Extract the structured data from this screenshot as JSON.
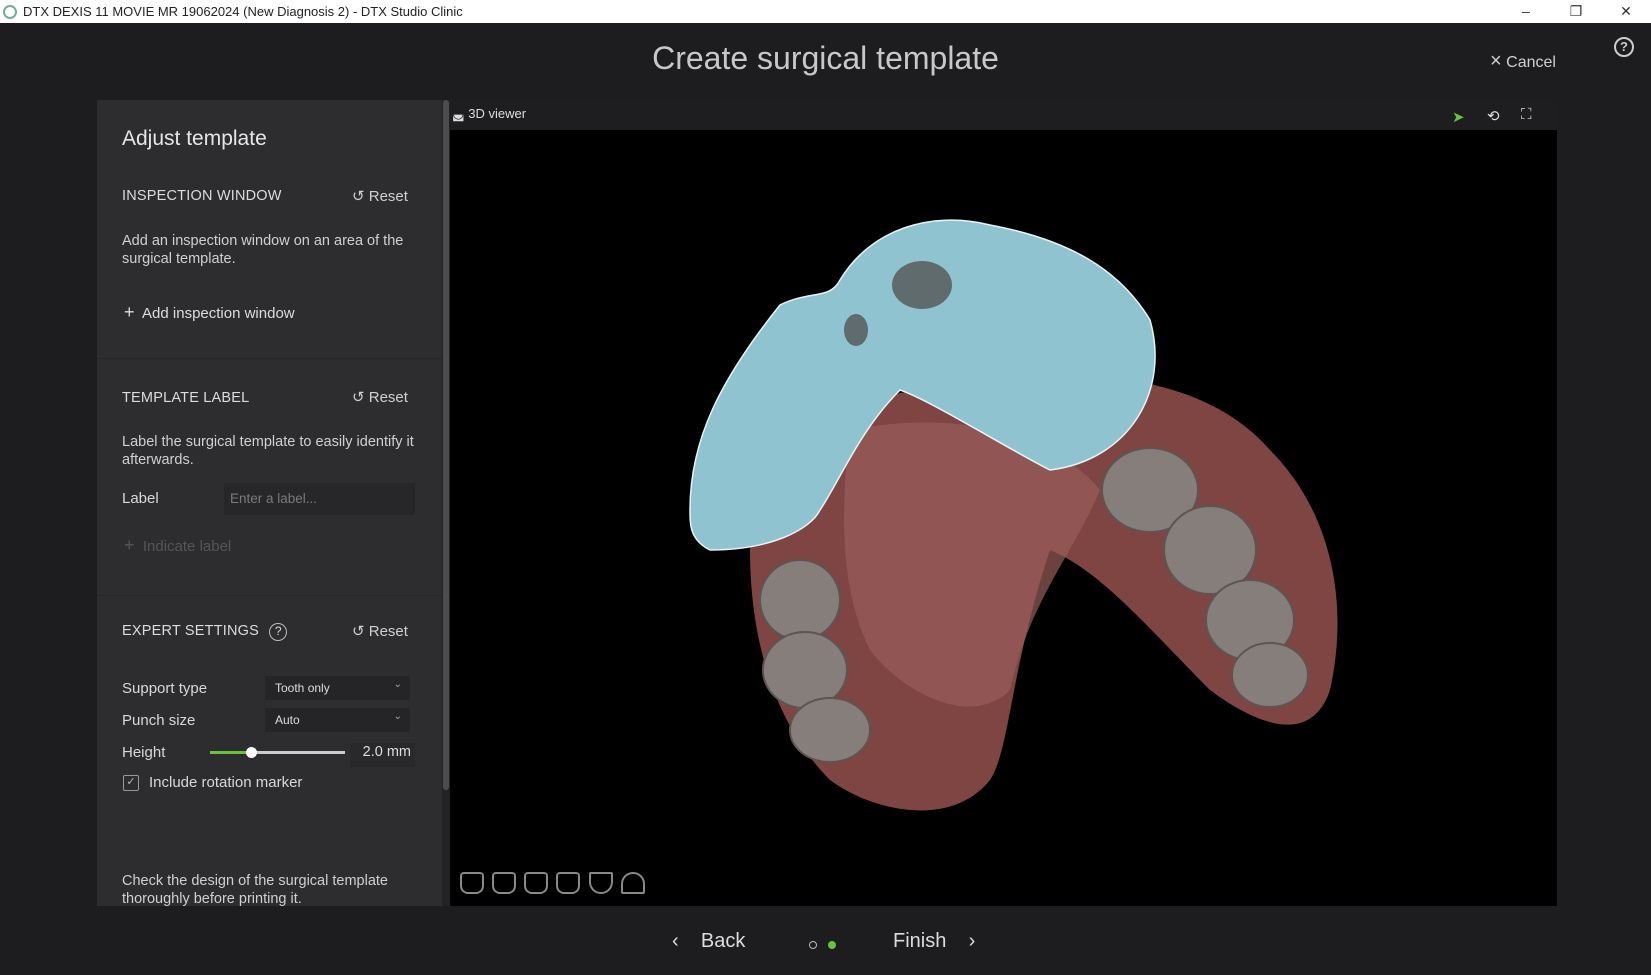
{
  "window": {
    "title": "DTX DEXIS 11 MOVIE MR 19062024 (New Diagnosis 2) - DTX Studio Clinic",
    "minimize": "‒",
    "restore": "❐",
    "close": "✕"
  },
  "header": {
    "title": "Create surgical template",
    "cancel_label": "Cancel",
    "cancel_icon": "×",
    "help_icon": "?"
  },
  "panel": {
    "title": "Adjust template",
    "inspection": {
      "heading": "INSPECTION WINDOW",
      "reset": "Reset",
      "description": "Add an inspection window on an area of the surgical template.",
      "add_label": "Add inspection window"
    },
    "label_section": {
      "heading": "TEMPLATE LABEL",
      "reset": "Reset",
      "description": "Label the surgical template to easily identify it afterwards.",
      "label": "Label",
      "input_value": "",
      "input_placeholder": "Enter a label...",
      "indicate_label": "Indicate label"
    },
    "expert": {
      "heading": "EXPERT SETTINGS",
      "reset": "Reset",
      "support_type_label": "Support type",
      "support_type_value": "Tooth only",
      "punch_size_label": "Punch size",
      "punch_size_value": "Auto",
      "height_label": "Height",
      "height_value": "2.0 mm",
      "height_fraction": 0.3,
      "rotation_marker_label": "Include rotation marker",
      "rotation_marker_checked": true
    },
    "footer_note": "Check the design of the surgical template thoroughly before printing it."
  },
  "viewer": {
    "title": "3D viewer",
    "colors": {
      "template": "#8fc3cf",
      "gum": "#8a4a48",
      "teeth": "#8a8380",
      "accent": "#69c33b"
    }
  },
  "nav": {
    "back": "Back",
    "finish": "Finish",
    "step_current": 2,
    "step_total": 2
  }
}
